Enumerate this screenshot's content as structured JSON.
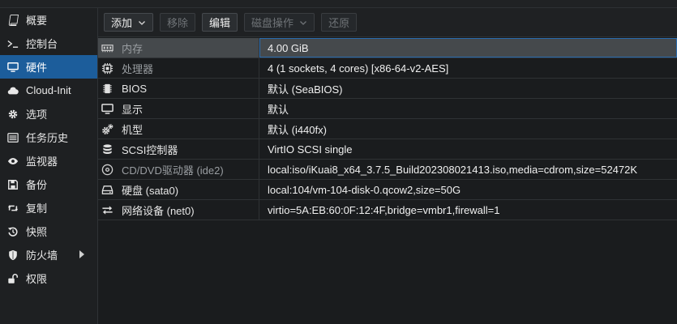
{
  "sidebar": {
    "items": [
      {
        "label": "概要",
        "icon": "book-icon"
      },
      {
        "label": "控制台",
        "icon": "terminal-icon"
      },
      {
        "label": "硬件",
        "icon": "monitor-icon",
        "active": true
      },
      {
        "label": "Cloud-Init",
        "icon": "cloud-icon"
      },
      {
        "label": "选项",
        "icon": "gear-icon"
      },
      {
        "label": "任务历史",
        "icon": "list-icon"
      },
      {
        "label": "监视器",
        "icon": "eye-icon"
      },
      {
        "label": "备份",
        "icon": "floppy-icon"
      },
      {
        "label": "复制",
        "icon": "retweet-icon"
      },
      {
        "label": "快照",
        "icon": "history-icon"
      },
      {
        "label": "防火墙",
        "icon": "shield-icon",
        "has_submenu": true
      },
      {
        "label": "权限",
        "icon": "unlock-icon"
      }
    ]
  },
  "toolbar": {
    "add_label": "添加",
    "remove_label": "移除",
    "edit_label": "编辑",
    "disk_action_label": "磁盘操作",
    "revert_label": "还原"
  },
  "hardware": {
    "rows": [
      {
        "key": "内存",
        "value": "4.00 GiB",
        "icon": "memory-icon",
        "muted": true
      },
      {
        "key": "处理器",
        "value": "4 (1 sockets, 4 cores) [x86-64-v2-AES]",
        "icon": "cpu-icon",
        "muted": true
      },
      {
        "key": "BIOS",
        "value": "默认 (SeaBIOS)",
        "icon": "chip-icon",
        "muted": false
      },
      {
        "key": "显示",
        "value": "默认",
        "icon": "desktop-icon",
        "muted": false
      },
      {
        "key": "机型",
        "value": "默认 (i440fx)",
        "icon": "cogs-icon",
        "muted": false
      },
      {
        "key": "SCSI控制器",
        "value": "VirtIO SCSI single",
        "icon": "database-icon",
        "muted": false
      },
      {
        "key": "CD/DVD驱动器 (ide2)",
        "value": "local:iso/iKuai8_x64_3.7.5_Build202308021413.iso,media=cdrom,size=52472K",
        "icon": "cdrom-icon",
        "muted": true
      },
      {
        "key": "硬盘 (sata0)",
        "value": "local:104/vm-104-disk-0.qcow2,size=50G",
        "icon": "hdd-icon",
        "muted": false
      },
      {
        "key": "网络设备 (net0)",
        "value": "virtio=5A:EB:60:0F:12:4F,bridge=vmbr1,firewall=1",
        "icon": "exchange-icon",
        "muted": false
      }
    ]
  },
  "colors": {
    "active_nav": "#1c5d9b",
    "selected_row": "#45494c",
    "background": "#1a1c1e"
  }
}
